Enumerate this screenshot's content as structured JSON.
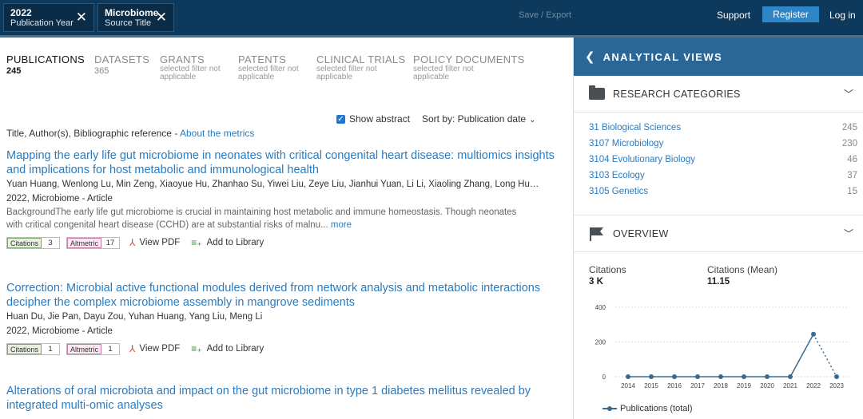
{
  "topbar": {
    "filters": [
      {
        "value": "2022",
        "label": "Publication Year"
      },
      {
        "value": "Microbiome",
        "label": "Source Title"
      }
    ],
    "save_export": "Save / Export",
    "support": "Support",
    "register": "Register",
    "login": "Log in"
  },
  "tabs": [
    {
      "name": "PUBLICATIONS",
      "count": "245"
    },
    {
      "name": "DATASETS",
      "count": "365"
    },
    {
      "name": "GRANTS",
      "note": "selected filter not applicable"
    },
    {
      "name": "PATENTS",
      "note": "selected filter not applicable"
    },
    {
      "name": "CLINICAL TRIALS",
      "note": "selected filter not applicable"
    },
    {
      "name": "POLICY DOCUMENTS",
      "note": "selected filter not applicable"
    }
  ],
  "toolbar": {
    "show_abstract": "Show abstract",
    "sort_label": "Sort by: Publication date"
  },
  "meta_line": {
    "text": "Title, Author(s), Bibliographic reference - ",
    "link": "About the metrics"
  },
  "results": [
    {
      "title": "Mapping the early life gut microbiome in neonates with critical congenital heart disease: multiomics insights and implications for host metabolic and immunological health",
      "authors": "Yuan Huang, Wenlong Lu, Min Zeng, Xiaoyue Hu, Zhanhao Su, Yiwei Liu, Zeye Liu, Jianhui Yuan, Li Li, Xiaoling Zhang, Long Huang...",
      "meta": "2022, Microbiome - Article",
      "abstract": "BackgroundThe early life gut microbiome is crucial in maintaining host metabolic and immune homeostasis. Though neonates with critical congenital heart disease (CCHD) are at substantial risks of malnu... ",
      "more": "more",
      "citations": "3",
      "altmetric": "17"
    },
    {
      "title": "Correction: Microbial active functional modules derived from network analysis and metabolic interactions decipher the complex microbiome assembly in mangrove sediments",
      "authors": "Huan Du, Jie Pan, Dayu Zou, Yuhan Huang, Yang Liu, Meng Li",
      "meta": "2022, Microbiome - Article",
      "citations": "1",
      "altmetric": "1"
    },
    {
      "title": "Alterations of oral microbiota and impact on the gut microbiome in type 1 diabetes mellitus revealed by integrated multi-omic analyses"
    }
  ],
  "actions": {
    "citations_label": "Citations",
    "altmetric_label": "Altmetric",
    "view_pdf": "View PDF",
    "add_library": "Add to Library"
  },
  "analytical": {
    "title": "ANALYTICAL VIEWS",
    "research_title": "RESEARCH CATEGORIES",
    "categories": [
      {
        "name": "31 Biological Sciences",
        "count": "245"
      },
      {
        "name": "3107 Microbiology",
        "count": "230"
      },
      {
        "name": "3104 Evolutionary Biology",
        "count": "46"
      },
      {
        "name": "3103 Ecology",
        "count": "37"
      },
      {
        "name": "3105 Genetics",
        "count": "15"
      }
    ],
    "overview_title": "OVERVIEW",
    "citations_label": "Citations",
    "citations_value": "3 K",
    "mean_label": "Citations (Mean)",
    "mean_value": "11.15"
  },
  "chart_data": {
    "type": "line",
    "x": [
      "2014",
      "2015",
      "2016",
      "2017",
      "2018",
      "2019",
      "2020",
      "2021",
      "2022",
      "2023"
    ],
    "series": [
      {
        "name": "Publications (total)",
        "values": [
          0,
          0,
          0,
          0,
          0,
          0,
          0,
          0,
          245,
          0
        ]
      }
    ],
    "ylim": [
      0,
      400
    ],
    "yticks": [
      "0",
      "200",
      "400"
    ],
    "grid": true,
    "legend": "bottom-left",
    "color": "#3d6a8c"
  }
}
